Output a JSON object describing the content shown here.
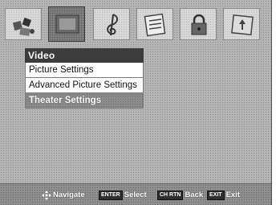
{
  "menu": {
    "title": "Video",
    "items": [
      {
        "label": "Picture Settings"
      },
      {
        "label": "Advanced Picture Settings"
      },
      {
        "label": "Theater Settings"
      }
    ],
    "selected_index": 2
  },
  "icons": [
    {
      "name": "setup-icon"
    },
    {
      "name": "video-icon",
      "selected": true
    },
    {
      "name": "audio-icon"
    },
    {
      "name": "preferences-icon"
    },
    {
      "name": "lock-icon"
    },
    {
      "name": "applications-icon"
    }
  ],
  "footer": {
    "navigate_label": "Navigate",
    "enter_key": "ENTER",
    "select_label": "Select",
    "back_key": "CH RTN",
    "back_label": "Back",
    "exit_key": "EXIT",
    "exit_label": "Exit"
  },
  "colors": {
    "header_bg": "#3c3c3c",
    "selected_item_bg": "#8c8c8c",
    "screen_bg": "#b4b4b4"
  }
}
